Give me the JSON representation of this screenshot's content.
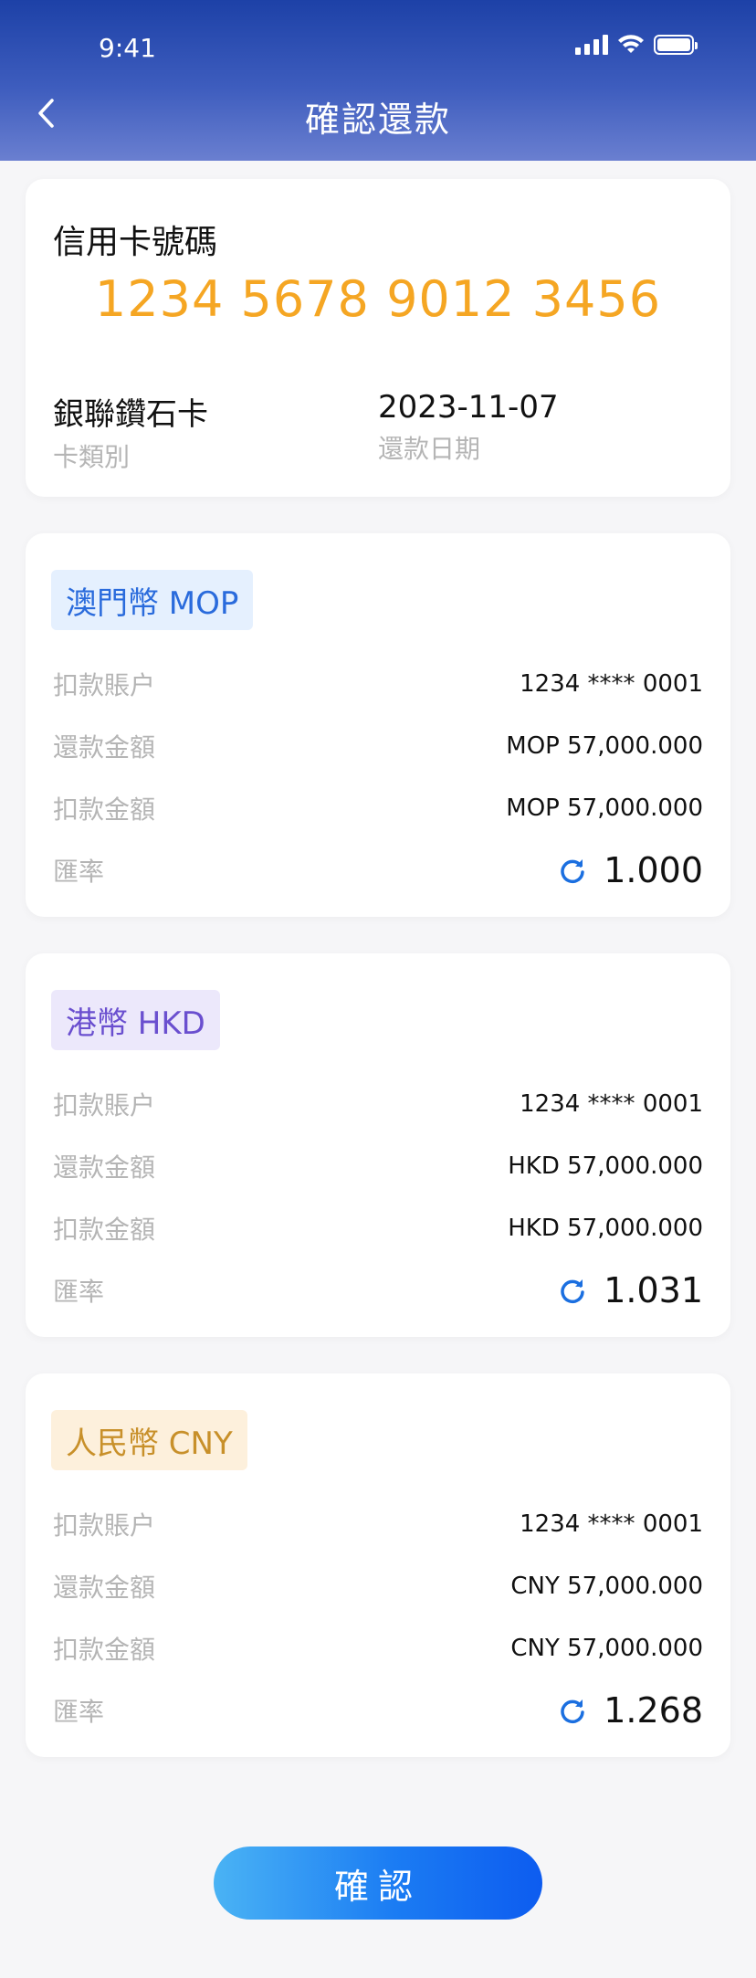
{
  "status_bar": {
    "time": "9:41"
  },
  "header": {
    "title": "確認還款"
  },
  "card_info": {
    "label": "信用卡號碼",
    "number": "1234 5678 9012 3456",
    "card_type_value": "銀聯鑽石卡",
    "card_type_label": "卡類別",
    "repay_date_value": "2023-11-07",
    "repay_date_label": "還款日期"
  },
  "currencies": [
    {
      "tag": "澳門幣 MOP",
      "tag_bg": "#e5f0fe",
      "tag_color": "#2a6bdc",
      "debit_account_label": "扣款賬户",
      "debit_account_value": "1234 **** 0001",
      "repay_amount_label": "還款金額",
      "repay_amount_value": "MOP 57,000.000",
      "debit_amount_label": "扣款金額",
      "debit_amount_value": "MOP 57,000.000",
      "rate_label": "匯率",
      "rate_value": "1.000"
    },
    {
      "tag": "港幣 HKD",
      "tag_bg": "#ece8fb",
      "tag_color": "#6a4fcf",
      "debit_account_label": "扣款賬户",
      "debit_account_value": "1234 **** 0001",
      "repay_amount_label": "還款金額",
      "repay_amount_value": "HKD 57,000.000",
      "debit_amount_label": "扣款金額",
      "debit_amount_value": "HKD 57,000.000",
      "rate_label": "匯率",
      "rate_value": "1.031"
    },
    {
      "tag": "人民幣 CNY",
      "tag_bg": "#fdf0dc",
      "tag_color": "#c8902a",
      "debit_account_label": "扣款賬户",
      "debit_account_value": "1234 **** 0001",
      "repay_amount_label": "還款金額",
      "repay_amount_value": "CNY 57,000.000",
      "debit_amount_label": "扣款金額",
      "debit_amount_value": "CNY 57,000.000",
      "rate_label": "匯率",
      "rate_value": "1.268"
    }
  ],
  "confirm_label": "確認",
  "colors": {
    "accent": "#1b7cf3",
    "card_number": "#f5a623",
    "header": "#1d41a7"
  },
  "icons": [
    "back-icon",
    "signal-icon",
    "wifi-icon",
    "battery-icon",
    "refresh-icon"
  ]
}
